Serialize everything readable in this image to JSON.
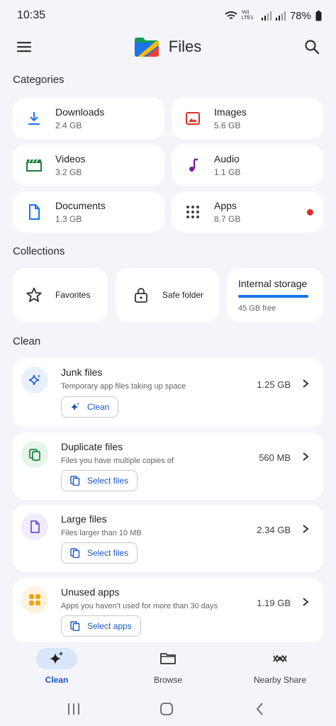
{
  "status_bar": {
    "time": "10:35",
    "network_label": "Vo) LTE1",
    "battery": "78%"
  },
  "app_bar": {
    "title": "Files",
    "menu_icon": "hamburger-menu-icon",
    "search_icon": "search-icon"
  },
  "categories": {
    "title": "Categories",
    "items": [
      {
        "name": "Downloads",
        "size": "2.4 GB",
        "icon": "download-icon",
        "color": "#1a73e8"
      },
      {
        "name": "Images",
        "size": "5.6 GB",
        "icon": "image-icon",
        "color": "#d93025"
      },
      {
        "name": "Videos",
        "size": "3.2 GB",
        "icon": "video-icon",
        "color": "#188038"
      },
      {
        "name": "Audio",
        "size": "1.1 GB",
        "icon": "music-note-icon",
        "color": "#7b1fa2"
      },
      {
        "name": "Documents",
        "size": "1.3 GB",
        "icon": "document-icon",
        "color": "#1a73e8"
      },
      {
        "name": "Apps",
        "size": "8.7 GB",
        "icon": "apps-grid-icon",
        "color": "#3c4043"
      }
    ]
  },
  "collections": {
    "title": "Collections",
    "favorites": "Favorites",
    "safe_folder": "Safe folder",
    "storage_title": "Internal storage",
    "storage_free": "45 GB free",
    "storage_used_fraction": 0.92
  },
  "clean": {
    "title": "Clean",
    "items": [
      {
        "title": "Junk files",
        "desc": "Temporary app files taking up space",
        "size": "1.25 GB",
        "action": "Clean",
        "icon": "sparkle-icon",
        "bg": "#e8f0fe"
      },
      {
        "title": "Duplicate files",
        "desc": "Files you have multiple copies of",
        "size": "560 MB",
        "action": "Select files",
        "icon": "duplicate-files-icon",
        "bg": "#e6f4ea"
      },
      {
        "title": "Large files",
        "desc": "Files larger than 10 MB",
        "size": "2.34 GB",
        "action": "Select files",
        "icon": "large-file-icon",
        "bg": "#f0ecfb"
      },
      {
        "title": "Unused apps",
        "desc": "Apps you haven't used for more than 30 days",
        "size": "1.19 GB",
        "action": "Select apps",
        "icon": "unused-apps-icon",
        "bg": "#fef3e0"
      }
    ]
  },
  "bottom_nav": {
    "items": [
      {
        "label": "Clean",
        "active": true
      },
      {
        "label": "Browse",
        "active": false
      },
      {
        "label": "Nearby Share",
        "active": false
      }
    ]
  },
  "colors": {
    "accent": "#1a57c9",
    "background": "#f4f5fb",
    "card": "#ffffff"
  }
}
